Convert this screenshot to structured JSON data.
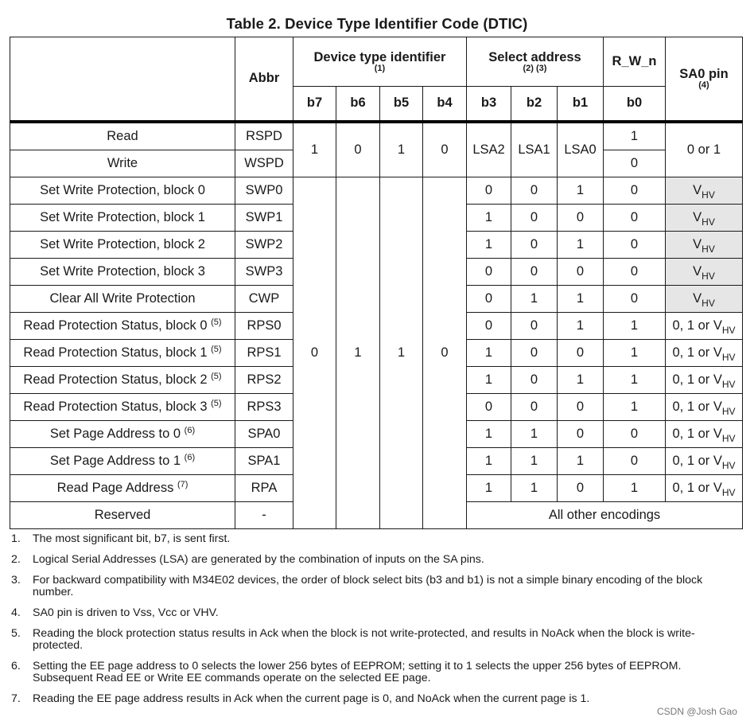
{
  "title": "Table 2. Device Type Identifier Code (DTIC)",
  "header": {
    "abbr": "Abbr",
    "device_type_identifier": "Device type identifier",
    "device_type_identifier_fn": "(1)",
    "select_address": "Select address",
    "select_address_fn": "(2) (3)",
    "rwn": "R_W_n",
    "sa0_pin": "SA0 pin",
    "sa0_pin_fn": "(4)",
    "bits": [
      "b7",
      "b6",
      "b5",
      "b4",
      "b3",
      "b2",
      "b1",
      "b0"
    ]
  },
  "spd_group": {
    "dti_bits": [
      "1",
      "0",
      "1",
      "0"
    ],
    "select": [
      "LSA2",
      "LSA1",
      "LSA0"
    ],
    "sa0": "0 or 1",
    "rows": [
      {
        "name": "Read",
        "abbr": "RSPD",
        "b0": "1"
      },
      {
        "name": "Write",
        "abbr": "WSPD",
        "b0": "0"
      }
    ]
  },
  "cmd_group": {
    "dti_bits": [
      "0",
      "1",
      "1",
      "0"
    ],
    "vhv_base": "V",
    "vhv_sub": "HV",
    "mixed_prefix": "0, 1 or V",
    "rows": [
      {
        "name": "Set Write Protection, block 0",
        "fn": "",
        "abbr": "SWP0",
        "b3": "0",
        "b2": "0",
        "b1": "1",
        "b0": "0",
        "sa0": "vhv"
      },
      {
        "name": "Set Write Protection, block 1",
        "fn": "",
        "abbr": "SWP1",
        "b3": "1",
        "b2": "0",
        "b1": "0",
        "b0": "0",
        "sa0": "vhv"
      },
      {
        "name": "Set Write Protection, block 2",
        "fn": "",
        "abbr": "SWP2",
        "b3": "1",
        "b2": "0",
        "b1": "1",
        "b0": "0",
        "sa0": "vhv"
      },
      {
        "name": "Set Write Protection, block 3",
        "fn": "",
        "abbr": "SWP3",
        "b3": "0",
        "b2": "0",
        "b1": "0",
        "b0": "0",
        "sa0": "vhv"
      },
      {
        "name": "Clear All Write Protection",
        "fn": "",
        "abbr": "CWP",
        "b3": "0",
        "b2": "1",
        "b1": "1",
        "b0": "0",
        "sa0": "vhv"
      },
      {
        "name": "Read Protection Status, block 0",
        "fn": "(5)",
        "abbr": "RPS0",
        "b3": "0",
        "b2": "0",
        "b1": "1",
        "b0": "1",
        "sa0": "mixed"
      },
      {
        "name": "Read Protection Status, block 1",
        "fn": "(5)",
        "abbr": "RPS1",
        "b3": "1",
        "b2": "0",
        "b1": "0",
        "b0": "1",
        "sa0": "mixed"
      },
      {
        "name": "Read Protection Status, block 2",
        "fn": "(5)",
        "abbr": "RPS2",
        "b3": "1",
        "b2": "0",
        "b1": "1",
        "b0": "1",
        "sa0": "mixed"
      },
      {
        "name": "Read Protection Status, block 3",
        "fn": "(5)",
        "abbr": "RPS3",
        "b3": "0",
        "b2": "0",
        "b1": "0",
        "b0": "1",
        "sa0": "mixed"
      },
      {
        "name": "Set Page Address to 0",
        "fn": "(6)",
        "abbr": "SPA0",
        "b3": "1",
        "b2": "1",
        "b1": "0",
        "b0": "0",
        "sa0": "mixed"
      },
      {
        "name": "Set Page Address to 1",
        "fn": "(6)",
        "abbr": "SPA1",
        "b3": "1",
        "b2": "1",
        "b1": "1",
        "b0": "0",
        "sa0": "mixed"
      },
      {
        "name": "Read Page Address",
        "fn": "(7)",
        "abbr": "RPA",
        "b3": "1",
        "b2": "1",
        "b1": "0",
        "b0": "1",
        "sa0": "mixed"
      }
    ],
    "reserved": {
      "name": "Reserved",
      "abbr": "-",
      "other": "All other encodings"
    }
  },
  "notes": [
    {
      "num": "1.",
      "text": "The most significant bit, b7, is sent first."
    },
    {
      "num": "2.",
      "text": "Logical Serial Addresses (LSA) are generated by the combination of inputs on the SA pins."
    },
    {
      "num": "3.",
      "text": "For backward compatibility with M34E02 devices, the order of block select bits (b3 and b1) is not a simple binary encoding of the block number."
    },
    {
      "num": "4.",
      "text": "SA0 pin is driven to Vss, Vcc or VHV."
    },
    {
      "num": "5.",
      "text": "Reading the block protection status results in Ack when the block is not write-protected, and results in NoAck when the block is write-protected."
    },
    {
      "num": "6.",
      "text": "Setting the EE page address to 0 selects the lower 256 bytes of EEPROM; setting it to 1 selects the upper 256 bytes of EEPROM. Subsequent Read EE or Write EE commands operate on the selected EE page."
    },
    {
      "num": "7.",
      "text": "Reading the EE page address results in Ack when the current page is 0, and NoAck when the current page is 1."
    }
  ],
  "watermark": "CSDN @Josh Gao",
  "colors": {
    "shade": "#e6e6e6",
    "rule": "#000000"
  }
}
